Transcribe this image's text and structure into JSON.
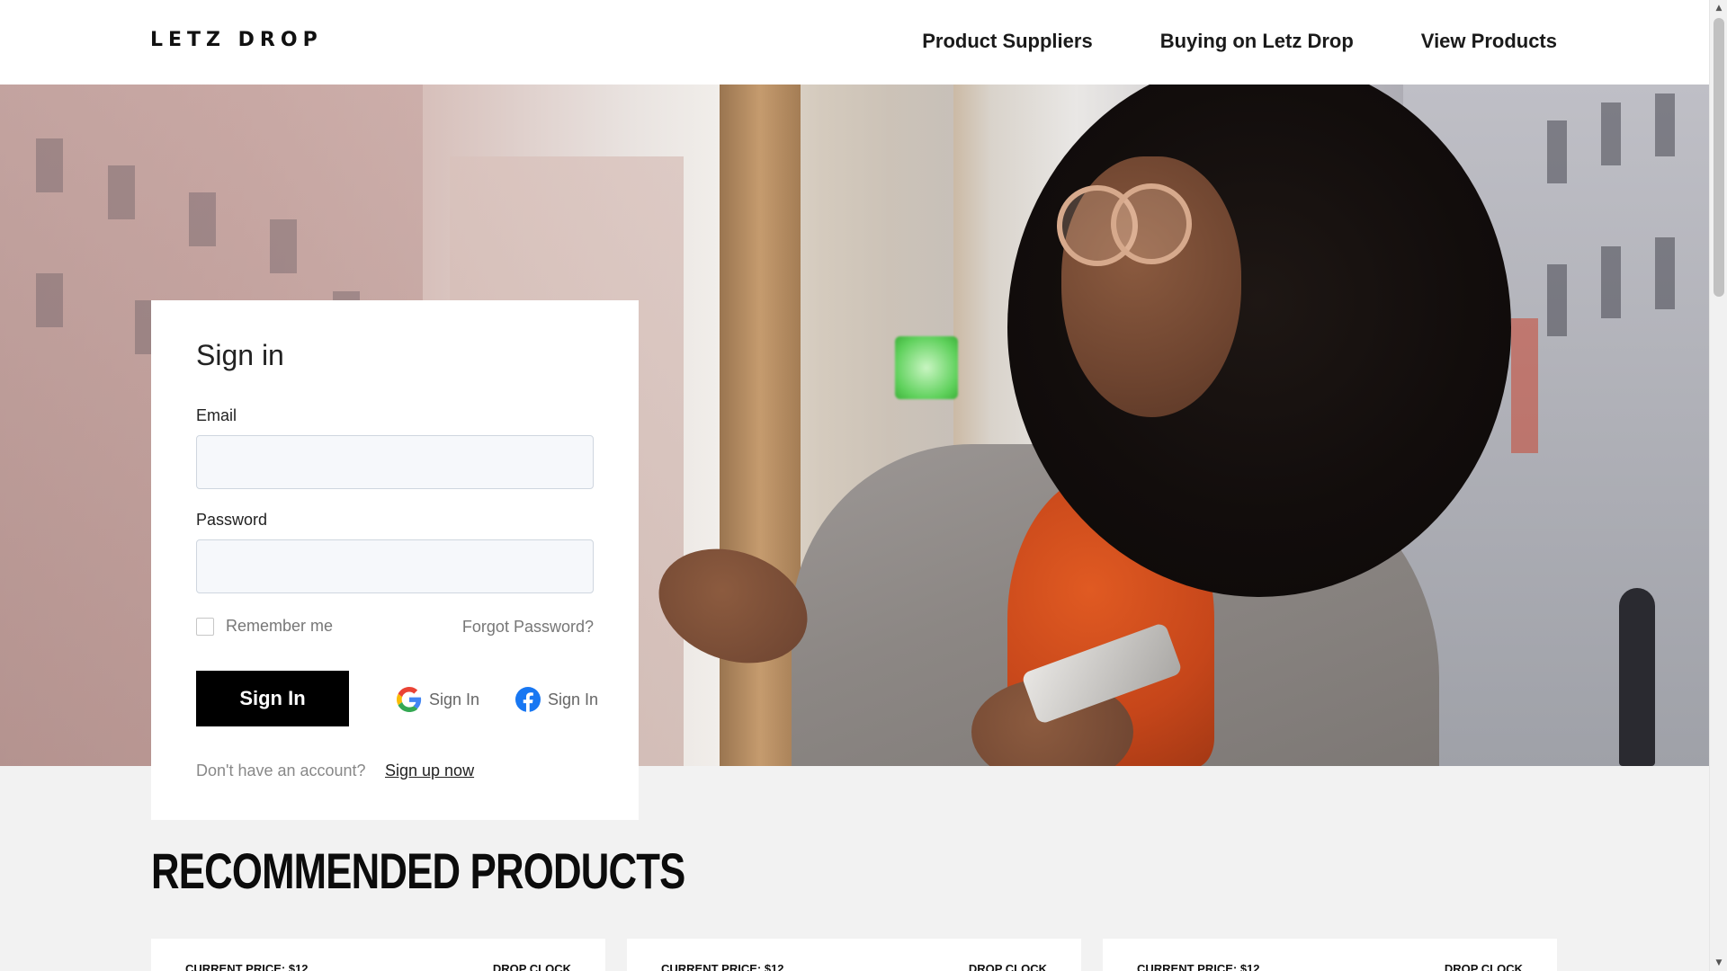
{
  "brand": {
    "logo": "LETZ DROP"
  },
  "nav": {
    "items": [
      "Product Suppliers",
      "Buying on Letz Drop",
      "View Products"
    ]
  },
  "signin": {
    "title": "Sign in",
    "email_label": "Email",
    "email_value": "",
    "password_label": "Password",
    "password_value": "",
    "remember_label": "Remember me",
    "remember_checked": false,
    "forgot_label": "Forgot Password?",
    "submit_label": "Sign In",
    "google_label": "Sign In",
    "facebook_label": "Sign In",
    "no_account_text": "Don't have an account?",
    "signup_label": "Sign up now"
  },
  "recommended": {
    "title": "RECOMMENDED PRODUCTS",
    "cards": [
      {
        "price": "CURRENT PRICE: $12",
        "clock": "DROP CLOCK"
      },
      {
        "price": "CURRENT PRICE: $12",
        "clock": "DROP CLOCK"
      },
      {
        "price": "CURRENT PRICE: $12",
        "clock": "DROP CLOCK"
      }
    ]
  },
  "icons": [
    "google-icon",
    "facebook-icon",
    "scroll-up-icon",
    "scroll-down-icon"
  ],
  "colors": {
    "primary_button": "#000000",
    "page_background": "#f2f2f2",
    "facebook_blue": "#1877f2"
  }
}
